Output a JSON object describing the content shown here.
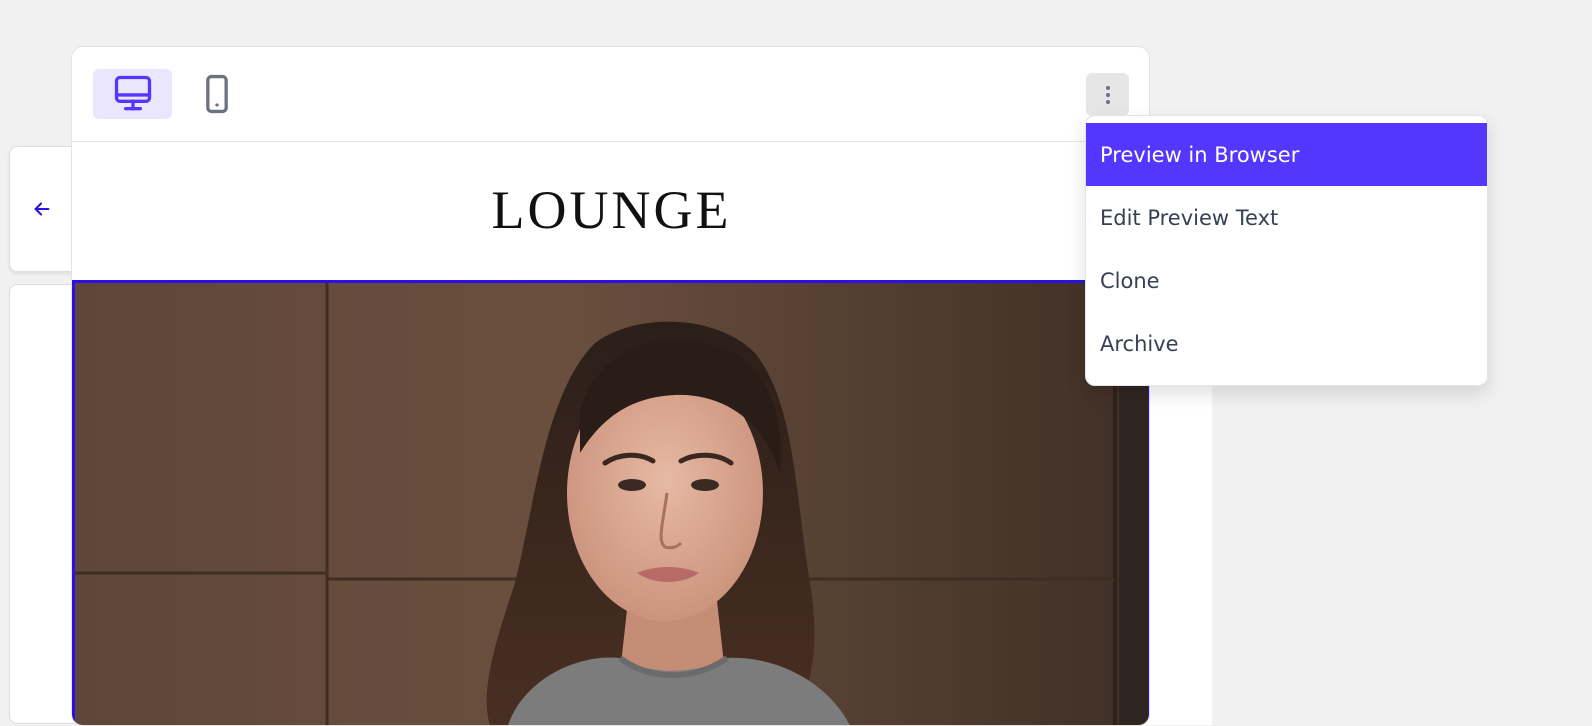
{
  "toolbar": {
    "devices": [
      {
        "name": "desktop",
        "icon": "desktop-monitor-icon",
        "active": true
      },
      {
        "name": "mobile",
        "icon": "mobile-phone-icon",
        "active": false
      }
    ],
    "more_icon": "vertical-ellipsis-icon"
  },
  "nav": {
    "back_icon": "arrow-left-icon"
  },
  "email": {
    "brand": "LOUNGE",
    "hero_image": "portrait-photo"
  },
  "menu": {
    "items": [
      {
        "label": "Preview in Browser",
        "active": true
      },
      {
        "label": "Edit Preview Text",
        "active": false
      },
      {
        "label": "Clone",
        "active": false
      },
      {
        "label": "Archive",
        "active": false
      }
    ]
  },
  "colors": {
    "accent": "#5436ff",
    "selection_border": "#2a10e6",
    "active_device_bg": "#e9e6fd"
  }
}
